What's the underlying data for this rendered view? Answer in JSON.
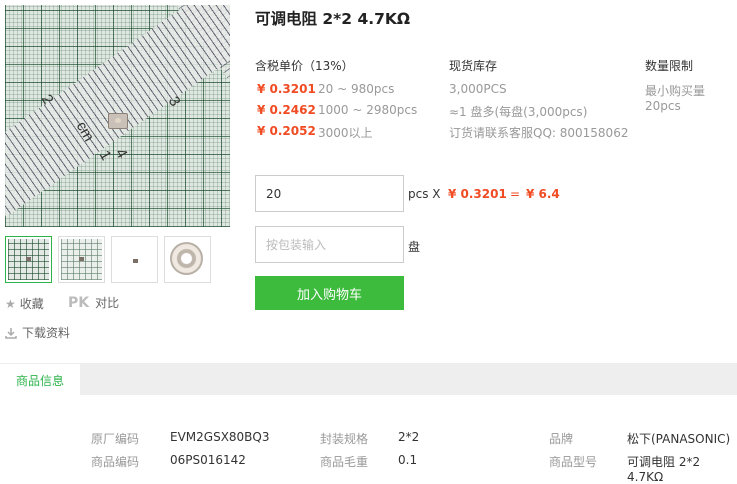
{
  "product": {
    "title": "可调电阻 2*2 4.7KΩ"
  },
  "gallery": {
    "ruler_numbers": [
      "2",
      "3",
      "cm",
      "1",
      "4"
    ]
  },
  "actions": {
    "favorite_label": "收藏",
    "pk_label": "PK",
    "compare_label": "对比",
    "download_label": "下载资料"
  },
  "pricing": {
    "header": "含税单价（13%）",
    "tiers": [
      {
        "price": "¥ 0.3201",
        "range": "20 ~ 980pcs"
      },
      {
        "price": "¥ 0.2462",
        "range": "1000 ~ 2980pcs"
      },
      {
        "price": "¥ 0.2052",
        "range": "3000以上"
      }
    ]
  },
  "stock": {
    "header": "现货库存",
    "quantity": "3,000PCS",
    "reel": "≈1 盘多(每盘(3,000pcs)",
    "contact": "订货请联系客服QQ: 800158062"
  },
  "limit": {
    "header": "数量限制",
    "min": "最小购买量20pcs"
  },
  "order": {
    "qty_value": "20",
    "unit_times": "pcs X",
    "unit_price": "¥ 0.3201",
    "equals": "=",
    "total": "¥ 6.4",
    "reel_placeholder": "按包装输入",
    "reel_unit": "盘",
    "add_to_cart": "加入购物车"
  },
  "tabs": {
    "info": "商品信息"
  },
  "specs": [
    {
      "label": "原厂编码",
      "value": "EVM2GSX80BQ3"
    },
    {
      "label": "商品编码",
      "value": "06PS016142"
    },
    {
      "label": "封装规格",
      "value": "2*2"
    },
    {
      "label": "商品毛重",
      "value": "0.1"
    },
    {
      "label": "品牌",
      "value": "松下(PANASONIC)"
    },
    {
      "label": "商品型号",
      "value": "可调电阻 2*2 4.7KΩ"
    }
  ]
}
